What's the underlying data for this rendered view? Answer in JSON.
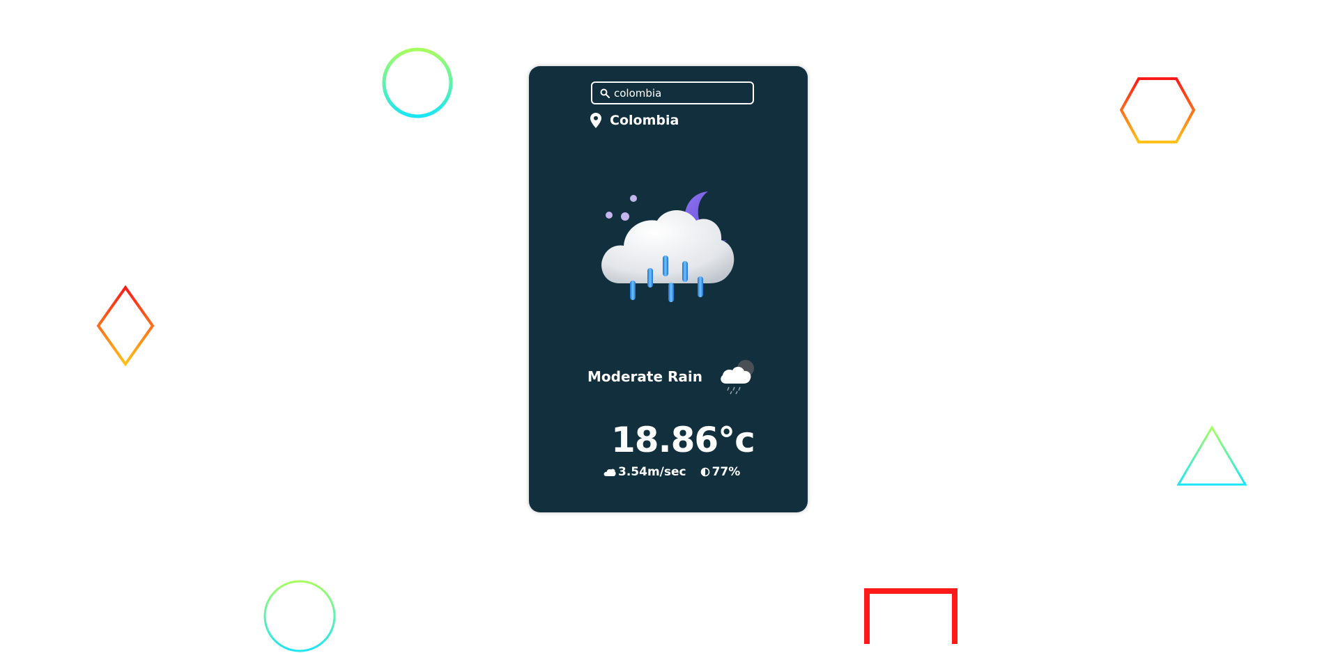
{
  "search": {
    "value": "colombia",
    "icon": "search-icon"
  },
  "location": {
    "icon": "location-pin-icon",
    "name": "Colombia"
  },
  "weather": {
    "illustration": "cloud-moon-rain-illustration",
    "condition": "Moderate Rain",
    "condition_icon": "cloud-rain-night-icon",
    "temperature": "18.86°c",
    "wind_icon": "cloud-icon",
    "wind_speed": "3.54m/sec",
    "humidity_icon": "humidity-drop-icon",
    "humidity": "77%"
  },
  "colors": {
    "card_background": "#112f3d",
    "text": "#ffffff",
    "moon": "#7b5fe0",
    "rain": "#2f8fe0"
  },
  "decorations": [
    "circle-outline",
    "hexagon-outline",
    "diamond-outline",
    "triangle-outline",
    "circle-outline",
    "square-outline"
  ]
}
